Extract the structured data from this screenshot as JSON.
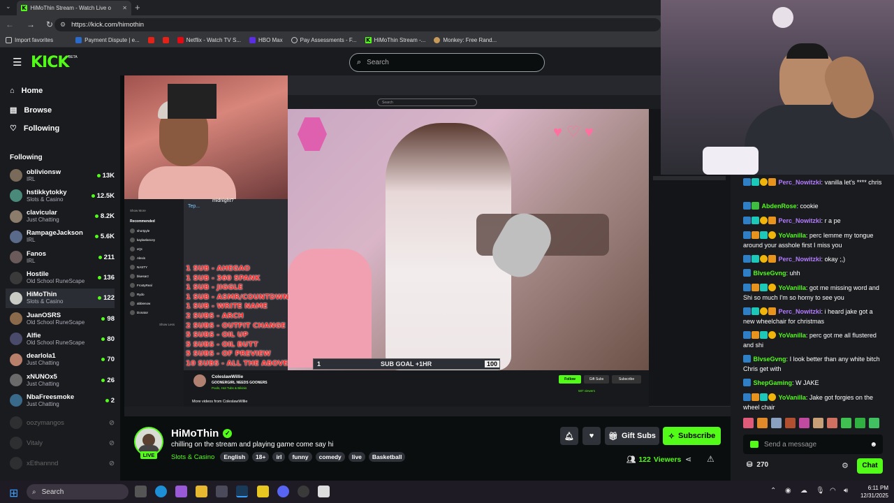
{
  "browser": {
    "tab_title": "HiMoThin Stream - Watch Live o",
    "url": "https://kick.com/himothin",
    "bookmarks": [
      "Import favorites",
      "Payment Dispute | e...",
      "Netflix - Watch TV S...",
      "HBO Max",
      "Pay Assessments - F...",
      "HiMoThin Stream -...",
      "Monkey: Free Rand..."
    ]
  },
  "header": {
    "logo": "KICK",
    "logo_sup": "BETA",
    "search_placeholder": "Search"
  },
  "nav": {
    "home": "Home",
    "browse": "Browse",
    "following": "Following",
    "section_title": "Following"
  },
  "following": [
    {
      "name": "oblivionsw",
      "category": "IRL",
      "viewers": "13K",
      "color": "#7a6a5a"
    },
    {
      "name": "hstikkytokky",
      "category": "Slots & Casino",
      "viewers": "12.5K",
      "color": "#4a8a7a"
    },
    {
      "name": "clavicular",
      "category": "Just Chatting",
      "viewers": "8.2K",
      "color": "#8c7c6c"
    },
    {
      "name": "RampageJackson",
      "category": "IRL",
      "viewers": "5.6K",
      "color": "#5a6a8a"
    },
    {
      "name": "Fanos",
      "category": "IRL",
      "viewers": "211",
      "color": "#6a5a5a"
    },
    {
      "name": "Hostile",
      "category": "Old School RuneScape",
      "viewers": "136",
      "color": "#3a3a3a"
    },
    {
      "name": "HiMoThin",
      "category": "Slots & Casino",
      "viewers": "122",
      "color": "#c8ccc4"
    },
    {
      "name": "JuanOSRS",
      "category": "Old School RuneScape",
      "viewers": "98",
      "color": "#8a6a4a"
    },
    {
      "name": "Alfie",
      "category": "Old School RuneScape",
      "viewers": "80",
      "color": "#4a4a6a"
    },
    {
      "name": "dearlola1",
      "category": "Just Chatting",
      "viewers": "70",
      "color": "#b8806a"
    },
    {
      "name": "xNUNOx5",
      "category": "Just Chatting",
      "viewers": "26",
      "color": "#6a6a6a"
    },
    {
      "name": "NbaFreesmoke",
      "category": "Just Chatting",
      "viewers": "2",
      "color": "#3a6a8a"
    }
  ],
  "offline": [
    "oozymangos",
    "Vitaly",
    "xEthannnd"
  ],
  "stream_overlay": {
    "inner_search": "Search",
    "sub_menu": [
      "1 SUB - AHEGAO",
      "1 SUB - 360 SPANK",
      "1 SUB - JIGGLE",
      "1 SUB - ASMR/COUNTDWN",
      "1 SUB - WRITE NAME",
      "2 SUBS - ARCH",
      "2 SUBS - OUTFIT CHANGE",
      "5 SUBS - OIL UP",
      "5 SUBS - OIL BUTT",
      "5 SUBS - OF PREVIEW",
      "10 SUBS - ALL THE ABOVE"
    ],
    "goal_left": "1",
    "goal_text": "SUB GOAL +1HR",
    "goal_right": "100",
    "inner_channel": "ColeslawWillie",
    "inner_title": "GOONERGIRL NEEDS GOONERS",
    "inner_category": "Pools, Hot Tubs & Bikinis",
    "inner_more": "More videos from ColeslawWillie",
    "inner_follow": "Follow",
    "inner_gift": "Gift Subs",
    "inner_sub": "Subscribe",
    "inner_viewers": "587 viewers",
    "inner_chat_bubble": "Tep...",
    "inner_midnight": "midnight?",
    "inner_recommended": "Recommended",
    "inner_showmore": "Show More",
    "inner_showless": "Show Less",
    "inner_rec_list": [
      "shortpyle",
      "kaylaelancey",
      "xQc",
      "Alexis",
      "NASTY",
      "bluesarz",
      "FrostyReal",
      "Rydo",
      "abbienow",
      "Donator"
    ]
  },
  "channel": {
    "name": "HiMoThin",
    "title": "chilling on the stream and playing game come say hi",
    "category": "Slots & Casino",
    "tags": [
      "English",
      "18+",
      "irl",
      "funny",
      "comedy",
      "live",
      "Basketball"
    ],
    "live": "LIVE",
    "viewers": "122",
    "viewers_label": "Viewers",
    "gift_label": "Gift Subs",
    "subscribe_label": "Subscribe",
    "accent": "#53fc18"
  },
  "chat": {
    "messages": [
      {
        "badges": [
          "blue",
          "cyan",
          "gold",
          "orange"
        ],
        "user": "Perc_Nowitzki",
        "color": "#b47cff",
        "text": "vanilla let's **** chris"
      },
      {
        "badges": [
          "blue",
          "green"
        ],
        "user": "AbdenRose",
        "color": "#53fc18",
        "text": "cookie"
      },
      {
        "badges": [
          "blue",
          "cyan",
          "gold",
          "orange"
        ],
        "user": "Perc_Nowitzki",
        "color": "#b47cff",
        "text": "r a pe"
      },
      {
        "badges": [
          "blue",
          "orange",
          "cyan",
          "gold"
        ],
        "user": "YoVanilla",
        "color": "#53fc18",
        "text": "perc lemme my tongue around your asshole first I miss you"
      },
      {
        "badges": [
          "blue",
          "cyan",
          "gold",
          "orange"
        ],
        "user": "Perc_Nowitzki",
        "color": "#b47cff",
        "text": "okay ;,)"
      },
      {
        "badges": [
          "blue"
        ],
        "user": "BlvseGvng",
        "color": "#53fc18",
        "text": "uhh"
      },
      {
        "badges": [
          "blue",
          "orange",
          "cyan",
          "gold"
        ],
        "user": "YoVanilla",
        "color": "#53fc18",
        "text": "got me missing word and Shi so much I'm so horny to see you"
      },
      {
        "badges": [
          "blue",
          "cyan",
          "gold",
          "orange"
        ],
        "user": "Perc_Nowitzki",
        "color": "#b47cff",
        "text": "i heard jake got a new wheelchair for christmas"
      },
      {
        "badges": [
          "blue",
          "orange",
          "cyan",
          "gold"
        ],
        "user": "YoVanilla",
        "color": "#53fc18",
        "text": "perc got me all flustered and shi"
      },
      {
        "badges": [
          "blue"
        ],
        "user": "BlvseGvng",
        "color": "#53fc18",
        "text": "I look better than any white bitch Chris get with"
      },
      {
        "badges": [
          "blue"
        ],
        "user": "ShepGaming",
        "color": "#53fc18",
        "text": "W JAKE"
      },
      {
        "badges": [
          "blue",
          "orange",
          "cyan",
          "gold"
        ],
        "user": "YoVanilla",
        "color": "#53fc18",
        "text": "Jake got forgies on the wheel chair"
      }
    ],
    "input_placeholder": "Send a message",
    "points": "270",
    "send_label": "Chat"
  },
  "taskbar": {
    "search": "Search",
    "time": "6:11 PM",
    "date": "12/31/2025"
  }
}
